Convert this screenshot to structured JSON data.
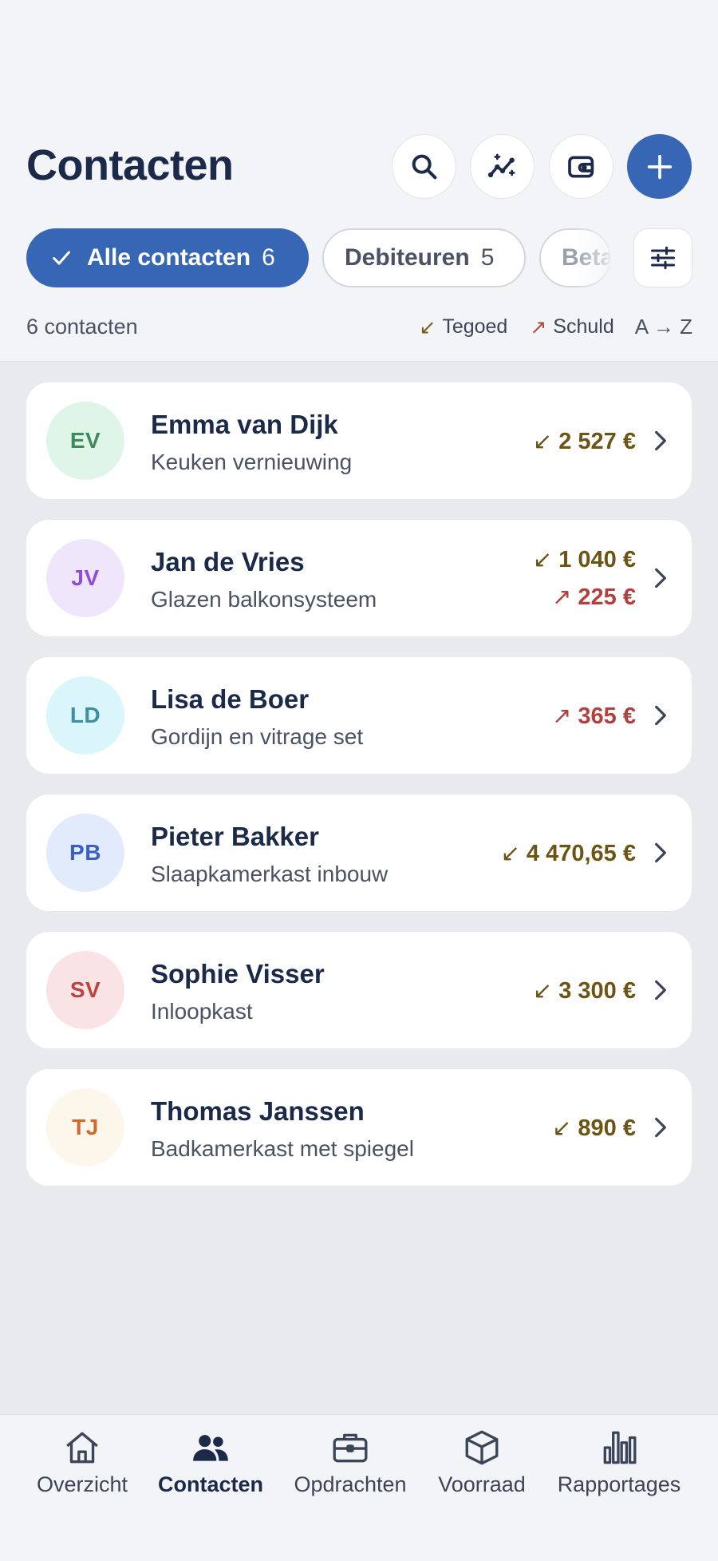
{
  "header": {
    "title": "Contacten"
  },
  "actions": {
    "search": "search-icon",
    "insights": "sparkle-chart-icon",
    "wallet": "wallet-icon",
    "add": "plus-icon"
  },
  "filters": {
    "all": {
      "label": "Alle contacten",
      "count": "6"
    },
    "debtors": {
      "label": "Debiteuren",
      "count": "5"
    },
    "third": {
      "label": "Beta"
    }
  },
  "summary": {
    "count_label": "6 contacten",
    "legend_credit": "Tegoed",
    "legend_debt": "Schuld",
    "sort": "A → Z"
  },
  "contacts": [
    {
      "initials": "EV",
      "name": "Emma van Dijk",
      "sub": "Keuken vernieuwing",
      "credit": "2 527 €",
      "debt": ""
    },
    {
      "initials": "JV",
      "name": "Jan de Vries",
      "sub": "Glazen balkonsysteem",
      "credit": "1 040 €",
      "debt": "225 €"
    },
    {
      "initials": "LD",
      "name": "Lisa de Boer",
      "sub": "Gordijn en vitrage set",
      "credit": "",
      "debt": "365 €"
    },
    {
      "initials": "PB",
      "name": "Pieter Bakker",
      "sub": "Slaapkamerkast inbouw",
      "credit": "4 470,65 €",
      "debt": ""
    },
    {
      "initials": "SV",
      "name": "Sophie Visser",
      "sub": "Inloopkast",
      "credit": "3 300 €",
      "debt": ""
    },
    {
      "initials": "TJ",
      "name": "Thomas Janssen",
      "sub": "Badkamerkast met spiegel",
      "credit": "890 €",
      "debt": ""
    }
  ],
  "avatar_colors": [
    {
      "bg": "#dff5e7",
      "fg": "#3e8a5d"
    },
    {
      "bg": "#efe6fb",
      "fg": "#8a4fd6"
    },
    {
      "bg": "#daf6fb",
      "fg": "#3c8ea3"
    },
    {
      "bg": "#e2ebfb",
      "fg": "#3a5fc0"
    },
    {
      "bg": "#fae3e4",
      "fg": "#c0403c"
    },
    {
      "bg": "#fdf6ea",
      "fg": "#cf6a2f"
    }
  ],
  "tabs": [
    {
      "label": "Overzicht"
    },
    {
      "label": "Contacten"
    },
    {
      "label": "Opdrachten"
    },
    {
      "label": "Voorraad"
    },
    {
      "label": "Rapportages"
    }
  ],
  "colors": {
    "primary": "#3766b5",
    "credit": "#6b5414",
    "debt": "#b0413e"
  }
}
